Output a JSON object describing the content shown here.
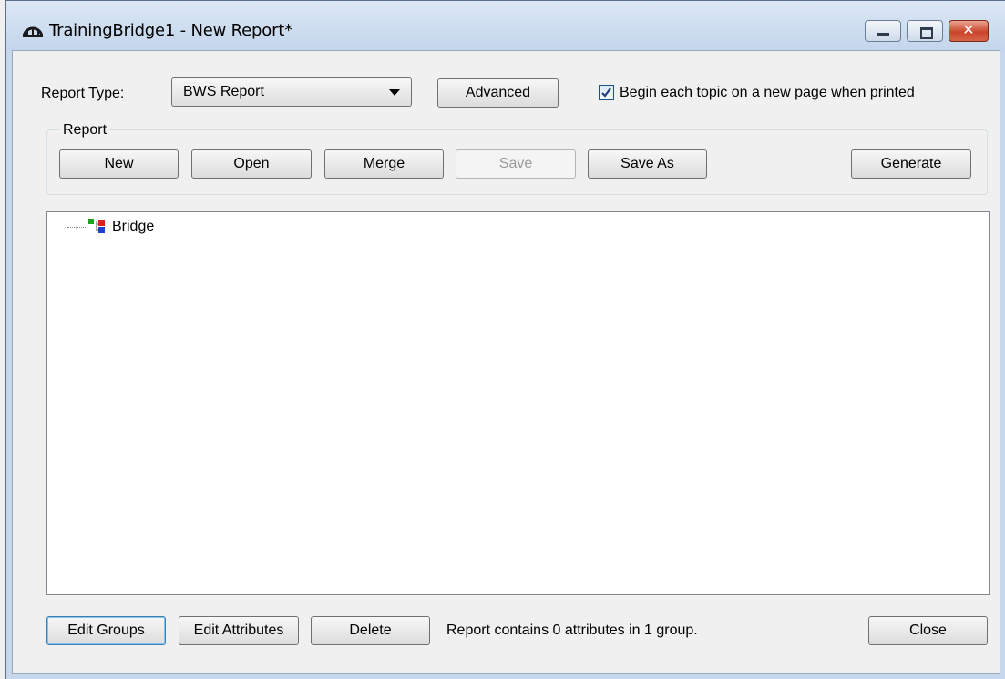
{
  "window": {
    "title": "TrainingBridge1 - New Report*",
    "icon": "bridge-app-icon"
  },
  "caption_buttons": {
    "minimize_icon": "minimize-icon",
    "maximize_icon": "maximize-icon",
    "close_glyph": "✕"
  },
  "report_type": {
    "label": "Report Type:",
    "selected": "BWS Report"
  },
  "advanced_label": "Advanced",
  "begin_topic": {
    "checked": true,
    "label": "Begin each topic on a new page when printed"
  },
  "report_group": {
    "label": "Report",
    "buttons": {
      "new": "New",
      "open": "Open",
      "merge": "Merge",
      "save": "Save",
      "save_as": "Save As",
      "generate": "Generate"
    }
  },
  "tree": {
    "root": {
      "label": "Bridge",
      "icon": "group-tree-icon"
    }
  },
  "footer": {
    "edit_groups": "Edit Groups",
    "edit_attributes": "Edit Attributes",
    "delete": "Delete",
    "status": "Report contains 0 attributes in 1 group.",
    "close": "Close"
  },
  "colors": {
    "title_gradient_top": "#dbe7f5",
    "close_button": "#c8452c",
    "tree_icon_green": "#1fa01f",
    "tree_icon_red": "#e02020",
    "tree_icon_blue": "#1f3fd0"
  }
}
